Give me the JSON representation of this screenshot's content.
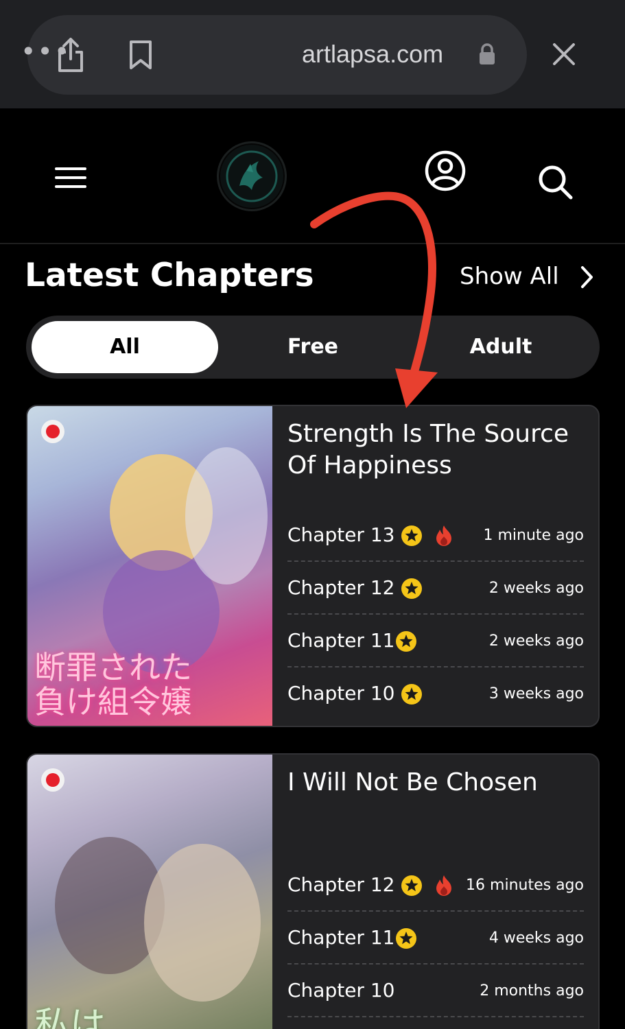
{
  "browser": {
    "more_label": "•••",
    "url": "artlapsa.com"
  },
  "header": {
    "logo_alt": "site logo"
  },
  "section": {
    "title": "Latest Chapters",
    "show_all": "Show All"
  },
  "tabs": [
    {
      "label": "All",
      "active": true
    },
    {
      "label": "Free",
      "active": false
    },
    {
      "label": "Adult",
      "active": false
    }
  ],
  "cards": [
    {
      "title": "Strength Is The Source Of Happiness",
      "chapters": [
        {
          "label": "Chapter 13",
          "star": true,
          "fire": true,
          "time": "1 minute ago"
        },
        {
          "label": "Chapter 12",
          "star": true,
          "fire": false,
          "time": "2 weeks ago"
        },
        {
          "label": "Chapter 11",
          "star": true,
          "fire": false,
          "time": "2 weeks ago"
        },
        {
          "label": "Chapter 10",
          "star": true,
          "fire": false,
          "time": "3 weeks ago"
        }
      ]
    },
    {
      "title": "I Will Not Be Chosen",
      "chapters": [
        {
          "label": "Chapter 12",
          "star": true,
          "fire": true,
          "time": "16 minutes ago"
        },
        {
          "label": "Chapter 11",
          "star": true,
          "fire": false,
          "time": "4 weeks ago"
        },
        {
          "label": "Chapter 10",
          "star": false,
          "fire": false,
          "time": "2 months ago"
        }
      ]
    }
  ],
  "colors": {
    "star": "#f5c518",
    "fire": "#e8402f",
    "annotation_arrow": "#e8402f"
  }
}
